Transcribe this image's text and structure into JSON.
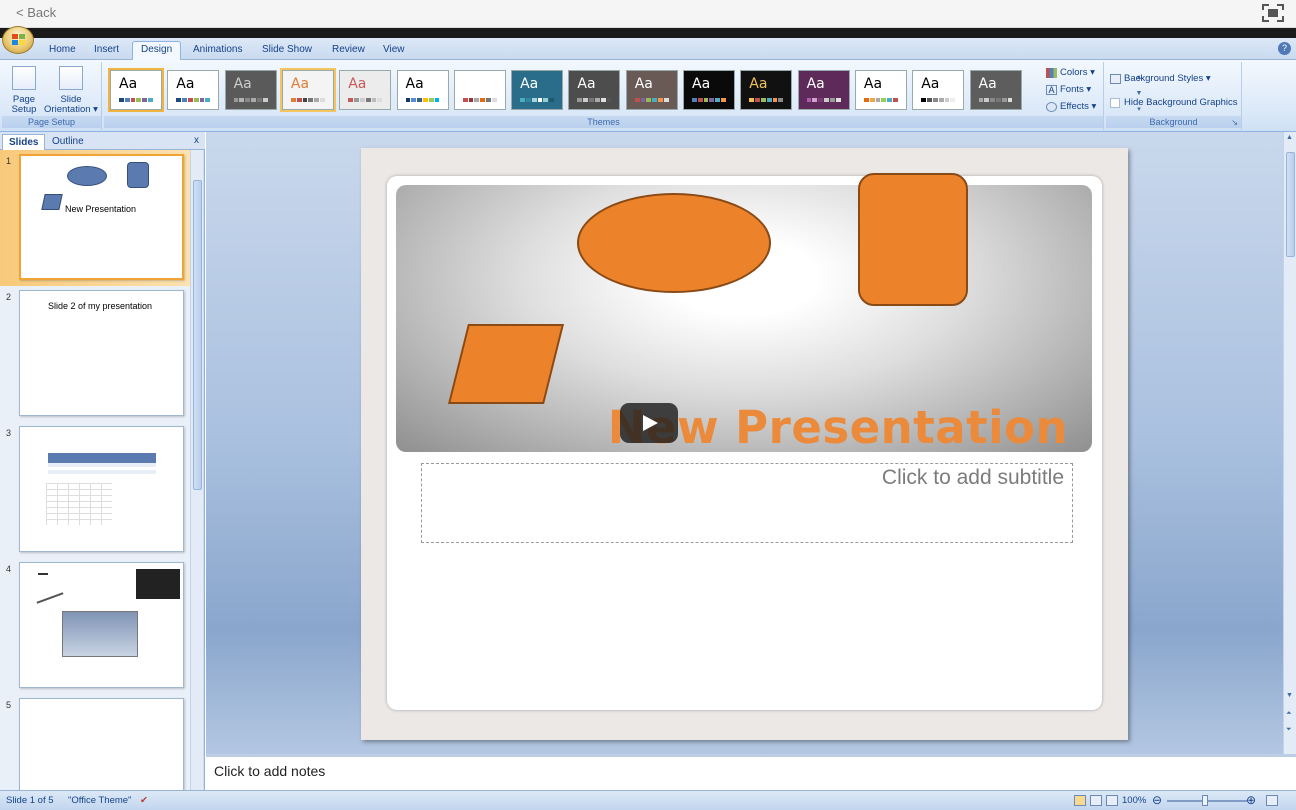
{
  "top_bar": {
    "back_label": "< Back"
  },
  "ribbon": {
    "tabs": [
      "Home",
      "Insert",
      "Design",
      "Animations",
      "Slide Show",
      "Review",
      "View"
    ],
    "active_tab": "Design",
    "page_setup": {
      "page_setup_label": "Page\nSetup",
      "slide_orientation_label": "Slide\nOrientation ▾",
      "group_label": "Page Setup"
    },
    "themes": {
      "group_label": "Themes",
      "thumb_text": "Aa",
      "items": [
        {
          "bg": "#ffffff",
          "fg": "#000000",
          "colors": [
            "#1f497d",
            "#4f81bd",
            "#c0504d",
            "#9bbb59",
            "#8064a2",
            "#4bacc6"
          ],
          "selected": true
        },
        {
          "bg": "#ffffff",
          "fg": "#000000",
          "colors": [
            "#1f497d",
            "#4f81bd",
            "#c0504d",
            "#9bbb59",
            "#8064a2",
            "#4bacc6"
          ]
        },
        {
          "bg": "#5a5a5a",
          "fg": "#cccccc",
          "colors": [
            "#999",
            "#b4b4b4",
            "#888",
            "#aaa",
            "#777",
            "#ccc"
          ]
        },
        {
          "bg": "#f4f4f4",
          "fg": "#e07b39",
          "colors": [
            "#e07b39",
            "#c0504d",
            "#444",
            "#777",
            "#aaa",
            "#ddd"
          ],
          "hover": true
        },
        {
          "bg": "#ececec",
          "fg": "#c55a5a",
          "colors": [
            "#c55a5a",
            "#999",
            "#ccc",
            "#777",
            "#bbb",
            "#ddd"
          ]
        },
        {
          "bg": "#ffffff",
          "fg": "#000000",
          "colors": [
            "#17375e",
            "#558ed5",
            "#376092",
            "#ffc000",
            "#92d050",
            "#00b0f0"
          ]
        },
        {
          "bg": "#ffffff",
          "fg": "#ffffff",
          "colors": [
            "#c0504d",
            "#953735",
            "#aaa",
            "#e46c0a",
            "#777",
            "#ddd"
          ]
        },
        {
          "bg": "#2a6d8a",
          "fg": "#ffffff",
          "colors": [
            "#4bacc6",
            "#31859c",
            "#a5d5e3",
            "#ffffff",
            "#92cddc",
            "#215968"
          ]
        },
        {
          "bg": "#4d4d4d",
          "fg": "#ffffff",
          "colors": [
            "#999",
            "#ccc",
            "#777",
            "#aaa",
            "#e0e0e0",
            "#555"
          ]
        },
        {
          "bg": "#6a5a55",
          "fg": "#ffffff",
          "colors": [
            "#c0504d",
            "#8064a2",
            "#9bbb59",
            "#4bacc6",
            "#f79646",
            "#ddd"
          ]
        },
        {
          "bg": "#0a0a0a",
          "fg": "#ffffff",
          "colors": [
            "#4f81bd",
            "#c0504d",
            "#9bbb59",
            "#8064a2",
            "#4bacc6",
            "#f79646"
          ]
        },
        {
          "bg": "#111111",
          "fg": "#f0c05a",
          "colors": [
            "#f0c05a",
            "#c0504d",
            "#9bbb59",
            "#4bacc6",
            "#f79646",
            "#888"
          ]
        },
        {
          "bg": "#5e2a5a",
          "fg": "#ffffff",
          "colors": [
            "#b05ca8",
            "#d4a0d0",
            "#7a3a76",
            "#ccc",
            "#999",
            "#e0e0e0"
          ]
        },
        {
          "bg": "#ffffff",
          "fg": "#000000",
          "colors": [
            "#e36c09",
            "#f2a54a",
            "#aaa",
            "#92d050",
            "#4bacc6",
            "#c0504d"
          ]
        },
        {
          "bg": "#ffffff",
          "fg": "#000000",
          "colors": [
            "#000",
            "#555",
            "#888",
            "#aaa",
            "#ccc",
            "#eee"
          ]
        },
        {
          "bg": "#5d5d5d",
          "fg": "#ffffff",
          "colors": [
            "#aaa",
            "#ccc",
            "#888",
            "#777",
            "#999",
            "#ddd"
          ]
        }
      ]
    },
    "theme_options": {
      "colors_label": "Colors ▾",
      "fonts_label": "Fonts ▾",
      "effects_label": "Effects ▾"
    },
    "background": {
      "group_label": "Background",
      "styles_label": "Background Styles ▾",
      "hide_graphics_label": "Hide Background Graphics"
    }
  },
  "left_pane": {
    "tabs": [
      "Slides",
      "Outline"
    ],
    "close_label": "x",
    "slides": [
      {
        "number": "1",
        "text": "New Presentation"
      },
      {
        "number": "2",
        "text": "Slide 2 of my presentation"
      },
      {
        "number": "3",
        "text": ""
      },
      {
        "number": "4",
        "text": ""
      },
      {
        "number": "5",
        "text": ""
      }
    ]
  },
  "slide": {
    "title": "New Presentation",
    "subtitle_placeholder": "Click to add subtitle",
    "shape_color": "#ec832b"
  },
  "notes": {
    "placeholder": "Click to add notes"
  },
  "status_bar": {
    "slide_info": "Slide 1 of 5",
    "theme_name": "\"Office Theme\"",
    "zoom": "100%"
  }
}
